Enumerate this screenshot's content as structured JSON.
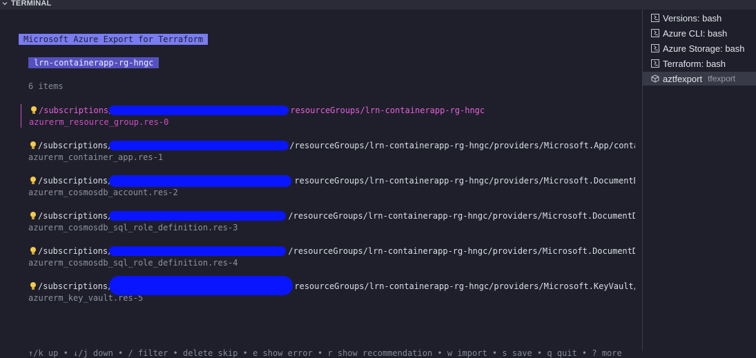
{
  "panel": {
    "title": "TERMINAL"
  },
  "app": {
    "title": "Microsoft Azure Export for Terraform",
    "resource_group": "lrn-containerapp-rg-hngc",
    "count_text": "6 items"
  },
  "items": [
    {
      "path_prefix": "/subscriptions/",
      "path_suffix": "resourceGroups/lrn-containerapp-rg-hngc",
      "name": "azurerm_resource_group.res-0"
    },
    {
      "path_prefix": "/subscriptions/",
      "path_suffix": "/resourceGroups/lrn-containerapp-rg-hngc/providers/Microsoft.App/contai",
      "name": "azurerm_container_app.res-1"
    },
    {
      "path_prefix": "/subscriptions/",
      "path_suffix": "resourceGroups/lrn-containerapp-rg-hngc/providers/Microsoft.DocumentDB",
      "name": "azurerm_cosmosdb_account.res-2"
    },
    {
      "path_prefix": "/subscriptions/",
      "path_suffix": "/resourceGroups/lrn-containerapp-rg-hngc/providers/Microsoft.DocumentDB",
      "name": "azurerm_cosmosdb_sql_role_definition.res-3"
    },
    {
      "path_prefix": "/subscriptions/",
      "path_suffix": "/resourceGroups/lrn-containerapp-rg-hngc/providers/Microsoft.DocumentDB",
      "name": "azurerm_cosmosdb_sql_role_definition.res-4"
    },
    {
      "path_prefix": "/subscriptions/",
      "path_suffix": "resourceGroups/lrn-containerapp-rg-hngc/providers/Microsoft.KeyVault/v",
      "name": "azurerm_key_vault.res-5"
    }
  ],
  "footer": {
    "help": "↑/k up • ↓/j down • / filter • delete skip • e show error • r show recommendation • w import • s save • q quit • ? more"
  },
  "sidebar": {
    "terminals": [
      {
        "label": "Versions: bash",
        "icon": "terminal-icon"
      },
      {
        "label": "Azure CLI: bash",
        "icon": "terminal-icon"
      },
      {
        "label": "Azure Storage: bash",
        "icon": "terminal-icon"
      },
      {
        "label": "Terraform: bash",
        "icon": "terminal-icon"
      },
      {
        "label": "aztfexport",
        "sublabel": "tfexport",
        "icon": "cube-icon",
        "active": true
      }
    ]
  },
  "colors": {
    "background": "#1e1f2b",
    "title_badge": "#7a7cf2",
    "group_badge": "#5550c0",
    "selected": "#e860d8",
    "redaction": "#0a15ff"
  }
}
